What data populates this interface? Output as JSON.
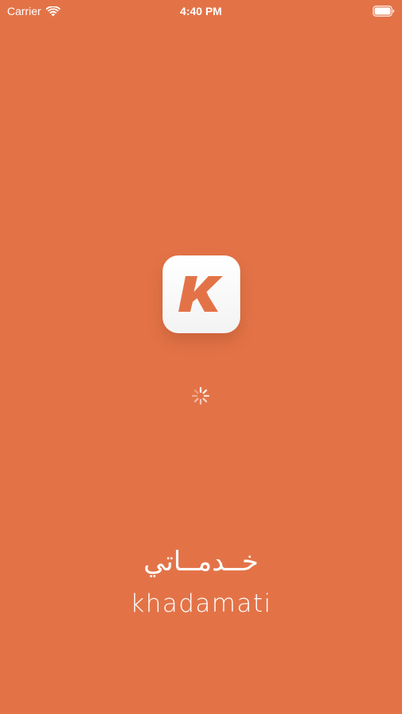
{
  "theme": {
    "background": "#E37347",
    "logo_glyph_color": "#E37347",
    "logo_tile_color": "#FFFFFF",
    "text_color": "#FFFFFF"
  },
  "status_bar": {
    "carrier": "Carrier",
    "time": "4:40 PM",
    "wifi_icon": "wifi-icon",
    "battery_icon": "battery-icon"
  },
  "splash": {
    "logo_icon": "khadamati-k-logo",
    "loading_indicator": "activity-spinner-icon",
    "brand_name_arabic": "خــدمــاتي",
    "brand_name_latin": "khadamati"
  }
}
